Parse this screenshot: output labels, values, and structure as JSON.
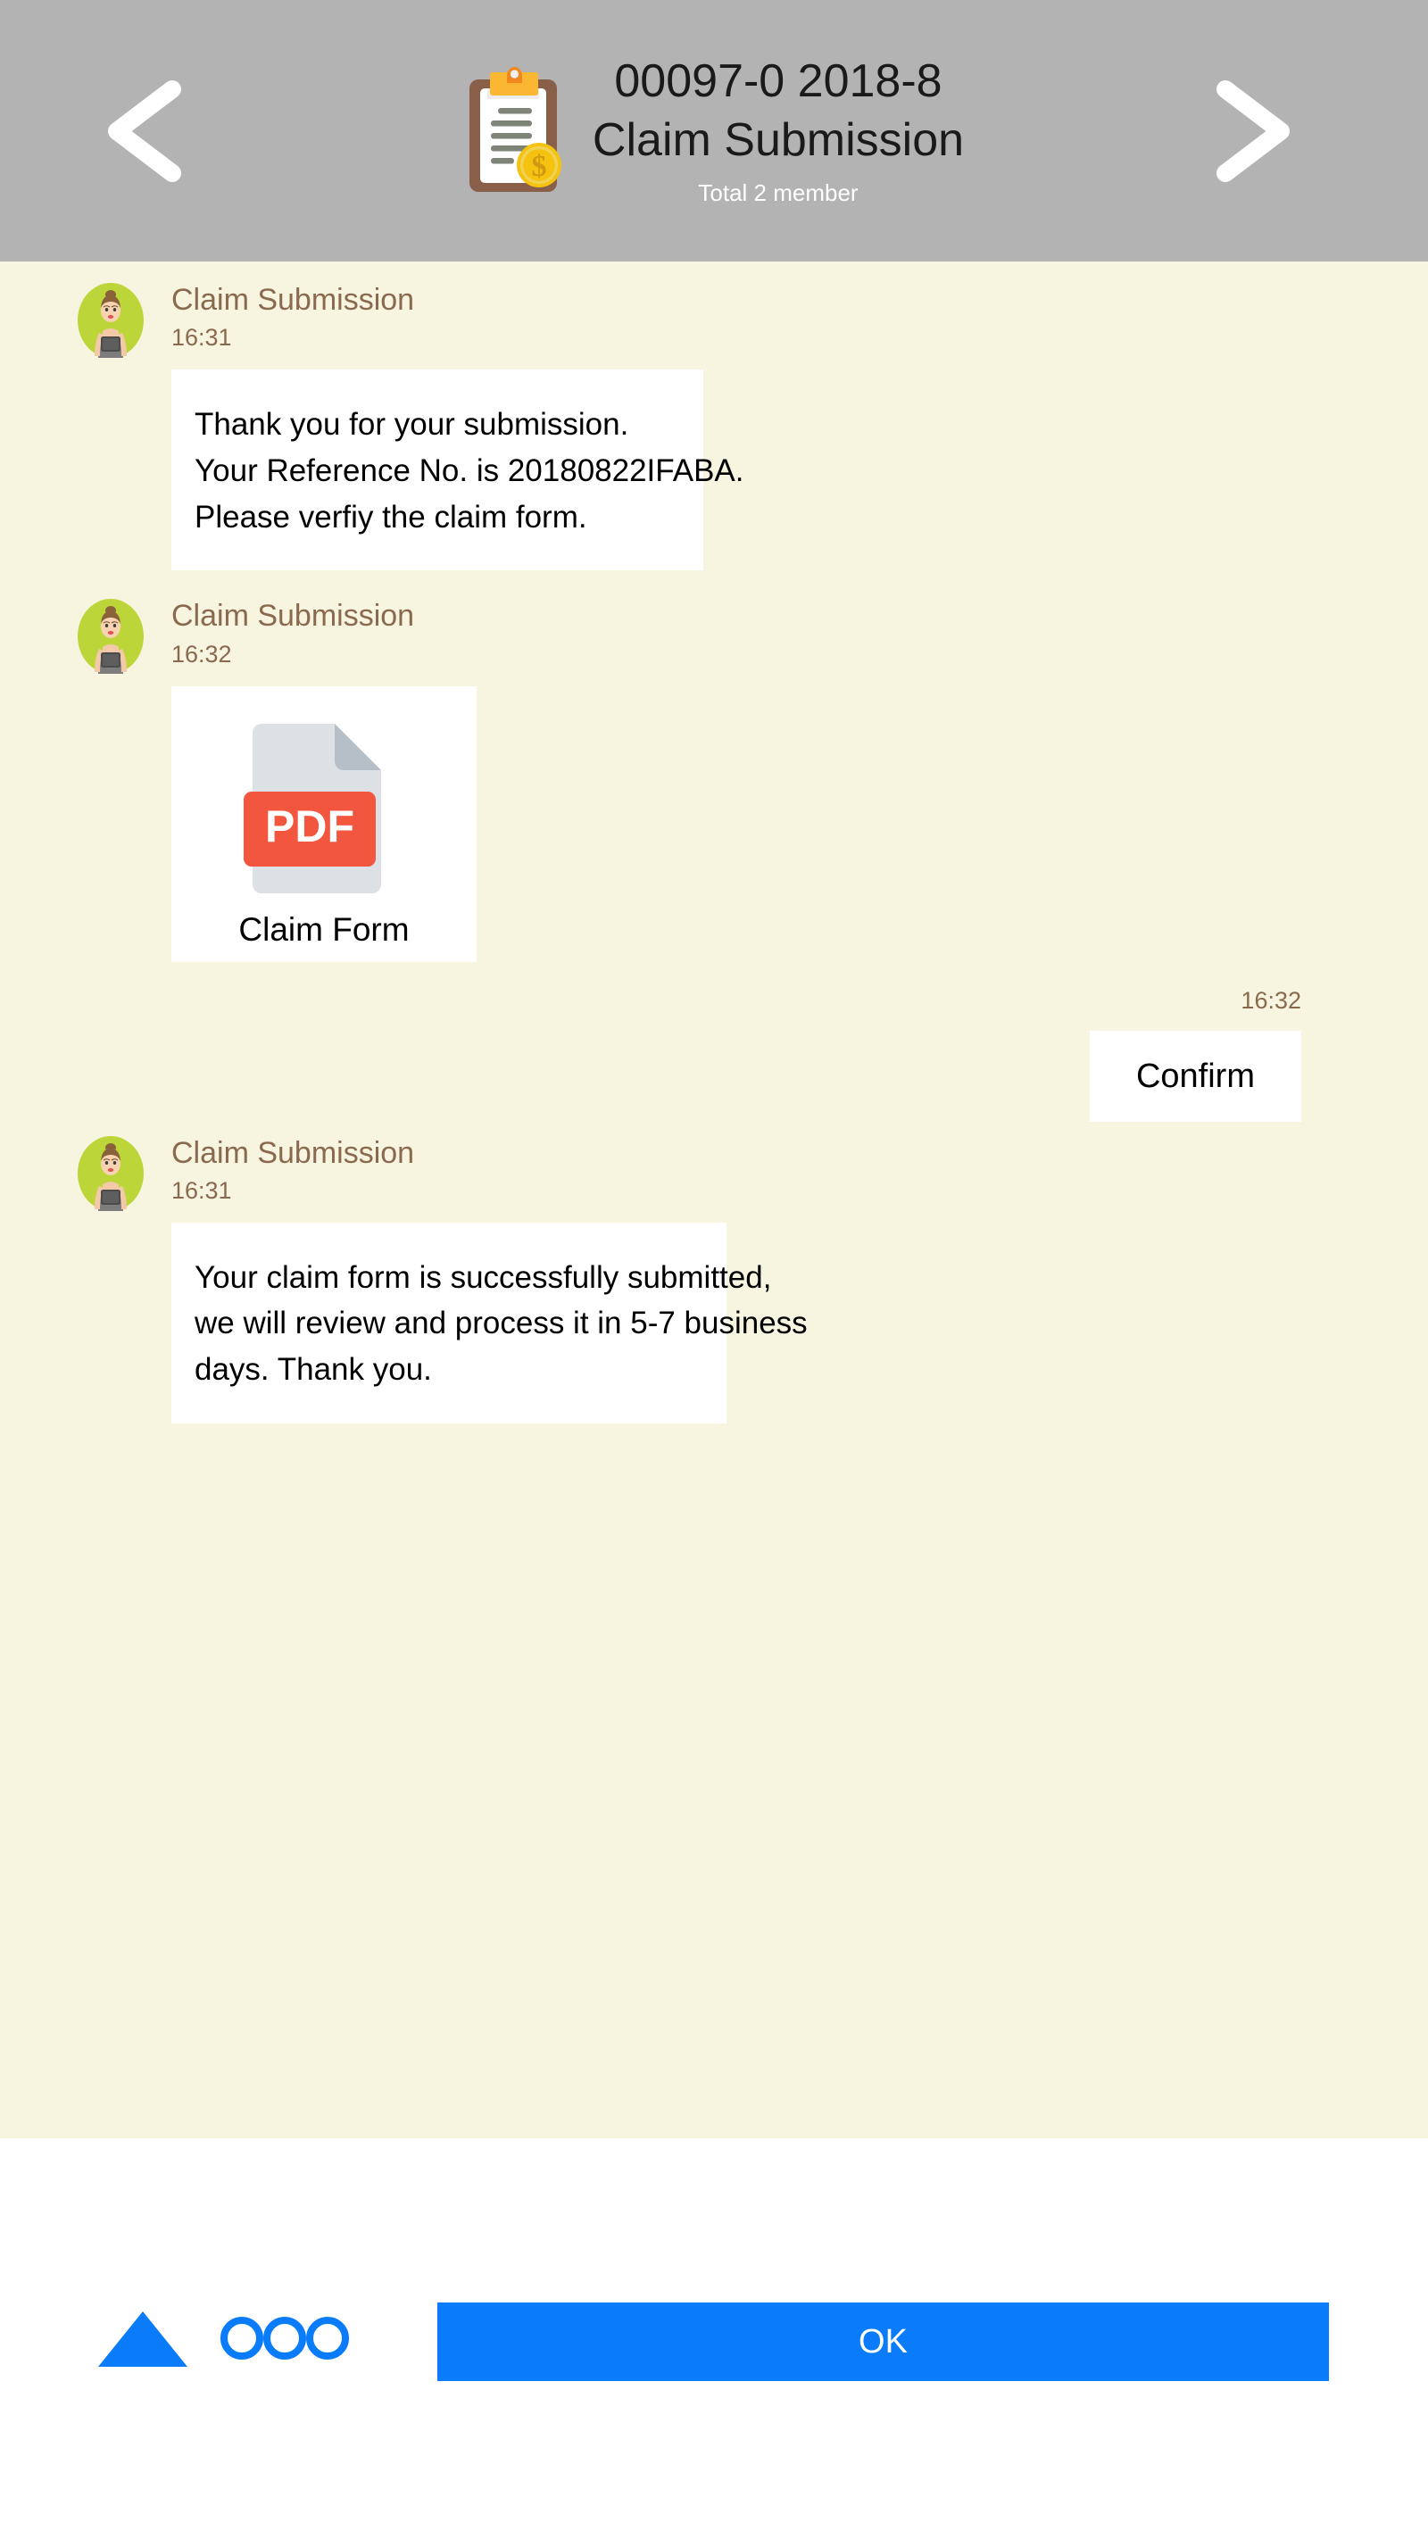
{
  "header": {
    "prev_icon": "chevron-left-icon",
    "next_icon": "chevron-right-icon",
    "app_icon": "clipboard-money-icon",
    "title_line1": "00097-0 2018-8",
    "title_line2": "Claim Submission",
    "subtitle": "Total 2 member",
    "background_color": "#b3b3b3"
  },
  "chat": {
    "background_color": "#f7f5e0",
    "sender_name_color": "#8a6a4f",
    "bubble_color": "#ffffff",
    "messages": [
      {
        "avatar_icon": "agent-avatar-icon",
        "sender": "Claim Submission",
        "time": "16:31",
        "side": "left",
        "type": "text",
        "lines": [
          "Thank you for your submission.",
          "Your Reference No. is 20180822IFABA.",
          "Please verfiy the claim form."
        ]
      },
      {
        "avatar_icon": "agent-avatar-icon",
        "sender": "Claim Submission",
        "time": "16:32",
        "side": "left",
        "type": "file",
        "file_label": "Claim Form",
        "file_badge": "PDF",
        "file_icon": "pdf-file-icon"
      },
      {
        "time": "16:32",
        "side": "right",
        "type": "button",
        "label": "Confirm"
      },
      {
        "avatar_icon": "agent-avatar-icon",
        "sender": "Claim Submission",
        "time": "16:31",
        "side": "left",
        "type": "text",
        "lines": [
          "Your claim form is successfully submitted,",
          "we will review and process it in 5-7 business",
          "days. Thank you."
        ]
      }
    ]
  },
  "footer": {
    "background_color": "#ffffff",
    "accent_color": "#0a7cfa",
    "triangle_icon": "triangle-up-icon",
    "dots_icon": "three-circles-icon",
    "ok_label": "OK"
  }
}
